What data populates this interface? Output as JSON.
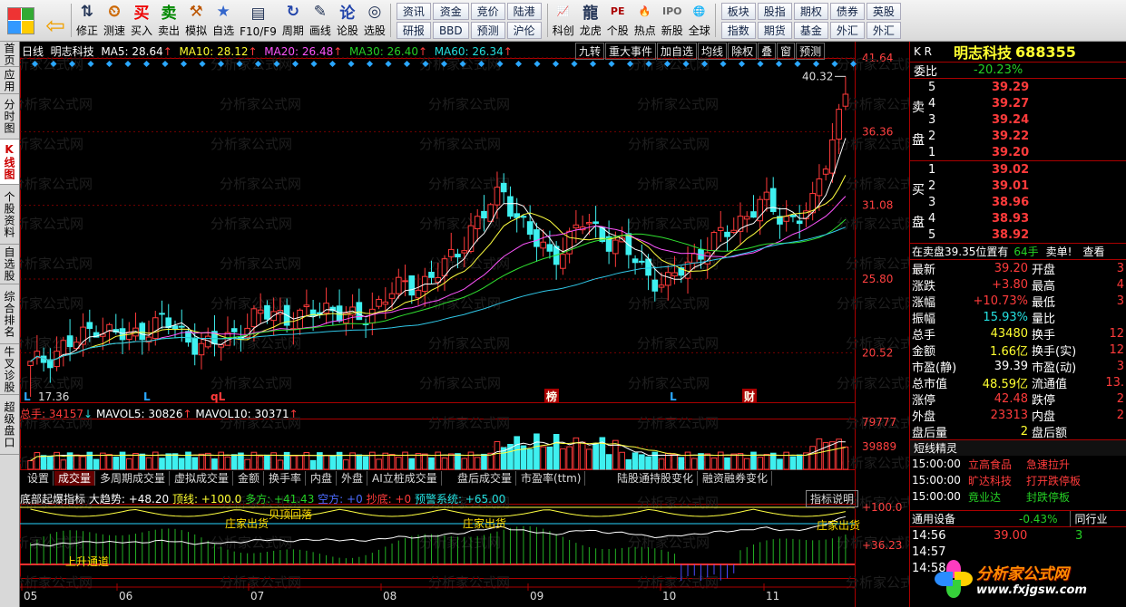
{
  "toolbar": {
    "buttons": [
      {
        "label": "修正",
        "icon": "up-down-arrows-icon"
      },
      {
        "label": "测速",
        "icon": "clock-icon"
      },
      {
        "label": "买入",
        "icon": "buy-icon"
      },
      {
        "label": "卖出",
        "icon": "sell-icon"
      },
      {
        "label": "模拟",
        "icon": "gavel-icon"
      },
      {
        "label": "自选",
        "icon": "star-icon"
      },
      {
        "label": "F10/F9",
        "icon": "document-icon"
      },
      {
        "label": "周期",
        "icon": "cycle-icon"
      },
      {
        "label": "画线",
        "icon": "pencil-icon"
      },
      {
        "label": "论股",
        "icon": "discussion-icon"
      },
      {
        "label": "选股",
        "icon": "stock-pick-icon"
      }
    ],
    "grid1": [
      "资讯",
      "研报",
      "资金",
      "BBD",
      "竞价",
      "预测",
      "陆港",
      "沪伦"
    ],
    "buttons2": [
      {
        "label": "科创",
        "icon": "sci-tech-icon"
      },
      {
        "label": "龙虎",
        "icon": "dragon-tiger-icon"
      },
      {
        "label": "个股",
        "icon": "pe-icon"
      },
      {
        "label": "热点",
        "icon": "hot-icon"
      },
      {
        "label": "新股",
        "icon": "ipo-icon"
      },
      {
        "label": "全球",
        "icon": "globe-icon"
      }
    ],
    "grid2": [
      "板块",
      "指数",
      "股指",
      "期货",
      "期权",
      "基金",
      "债券",
      "外汇",
      "英股",
      "外汇"
    ]
  },
  "left_tabs": [
    "首页",
    "应用",
    "分时图",
    "K线图",
    "个股资料",
    "自选股",
    "综合排名",
    "牛叉诊股",
    "超级盘口"
  ],
  "chart_header": {
    "period": "日线",
    "name": "明志科技",
    "ma5": "MA5: 28.64",
    "ma10": "MA10: 28.12",
    "ma20": "MA20: 26.48",
    "ma30": "MA30: 26.40",
    "ma60": "MA60: 26.34",
    "right_tabs": [
      "九转",
      "重大事件",
      "加自选",
      "均线",
      "除权",
      "叠",
      "窗",
      "预测"
    ]
  },
  "price_axis": [
    "41.64",
    "36.36",
    "31.08",
    "25.80",
    "20.52"
  ],
  "high_marker": "40.32",
  "low_marker": "17.36",
  "markers": [
    "L",
    "L",
    "qL",
    "榜",
    "L",
    "财"
  ],
  "volume_header": {
    "total": "总手: 34157",
    "mavol5": "MAVOL5: 30826",
    "mavol10": "MAVOL10: 30371"
  },
  "volume_axis": [
    "79777",
    "39889"
  ],
  "indicator_tabs": [
    "设置",
    "成交量",
    "多周期成交量",
    "虚拟成交量",
    "金额",
    "换手率",
    "内盘",
    "外盘",
    "AI立桩成交量",
    "盘后成交量",
    "市盈率(ttm)",
    "陆股通持股变化",
    "融资融券变化"
  ],
  "indicator_header": {
    "name": "底部起爆指标",
    "trend": "大趋势: +48.20",
    "top": "顶线: +100.0",
    "long": "多方: +41.43",
    "short": "空方: +0",
    "bottom": "抄底: +0",
    "alert": "预警系统: +65.00",
    "help": "指标说明"
  },
  "indicator_axis": [
    "+100.0",
    "+36.23"
  ],
  "indicator_labels": [
    "庄家出货",
    "贝顶回落",
    "庄家出货",
    "上升通道",
    "庄家出货"
  ],
  "x_axis": [
    "05",
    "06",
    "07",
    "08",
    "09",
    "10",
    "11"
  ],
  "quote": {
    "code": "688355",
    "name": "明志科技",
    "market": "K R",
    "weibi_label": "委比",
    "weibi": "-20.23%",
    "sell_label": "卖盘",
    "buy_label": "买盘",
    "asks": [
      {
        "lvl": "5",
        "price": "39.29"
      },
      {
        "lvl": "4",
        "price": "39.27"
      },
      {
        "lvl": "3",
        "price": "39.24"
      },
      {
        "lvl": "2",
        "price": "39.22"
      },
      {
        "lvl": "1",
        "price": "39.20"
      }
    ],
    "bids": [
      {
        "lvl": "1",
        "price": "39.02"
      },
      {
        "lvl": "2",
        "price": "39.01"
      },
      {
        "lvl": "3",
        "price": "38.96"
      },
      {
        "lvl": "4",
        "price": "38.93"
      },
      {
        "lvl": "5",
        "price": "38.92"
      }
    ],
    "position_note": "在卖盘39.35位置有",
    "position_vol": "64手",
    "position_sell": "卖单!",
    "position_view": "查看",
    "stats": [
      {
        "k": "最新",
        "v": "39.20",
        "k2": "开盘",
        "v2": "3"
      },
      {
        "k": "涨跌",
        "v": "+3.80",
        "k2": "最高",
        "v2": "4"
      },
      {
        "k": "涨幅",
        "v": "+10.73%",
        "k2": "最低",
        "v2": "3"
      },
      {
        "k": "振幅",
        "v": "15.93%",
        "k2": "量比",
        "v2": ""
      },
      {
        "k": "总手",
        "v": "43480",
        "k2": "换手",
        "v2": "12"
      },
      {
        "k": "金额",
        "v": "1.66亿",
        "k2": "换手(实)",
        "v2": "12"
      },
      {
        "k": "市盈(静)",
        "v": "39.39",
        "k2": "市盈(动)",
        "v2": "3"
      },
      {
        "k": "总市值",
        "v": "48.59亿",
        "k2": "流通值",
        "v2": "13."
      },
      {
        "k": "涨停",
        "v": "42.48",
        "k2": "跌停",
        "v2": "2"
      },
      {
        "k": "外盘",
        "v": "23313",
        "k2": "内盘",
        "v2": "2"
      },
      {
        "k": "盘后量",
        "v": "2",
        "k2": "盘后额",
        "v2": ""
      }
    ],
    "news_title": "短线精灵",
    "news": [
      {
        "t": "15:00:00",
        "stock": "立高食品",
        "event": "急速拉升"
      },
      {
        "t": "15:00:00",
        "stock": "旷达科技",
        "event": "打开跌停板"
      },
      {
        "t": "15:00:00",
        "stock": "竟业达",
        "event": "封跌停板"
      }
    ],
    "sector": {
      "name": "通用设备",
      "chg": "-0.43%",
      "tab": "同行业"
    },
    "ticks": [
      {
        "t": "14:56",
        "p": "39.00",
        "v": "3"
      },
      {
        "t": "14:57",
        "p": "",
        "v": ""
      },
      {
        "t": "14:58",
        "p": "",
        "v": ""
      }
    ]
  },
  "watermark": {
    "brand": "分析家公式网",
    "url": "www.fxjgsw.com"
  },
  "chart_data": {
    "type": "candlestick",
    "title": "明志科技 日线",
    "x": [
      "05",
      "06",
      "07",
      "08",
      "09",
      "10",
      "11"
    ],
    "ylim": [
      17.36,
      41.64
    ],
    "price_path": [
      19.5,
      20.2,
      21.0,
      21.3,
      22.6,
      21.9,
      21.5,
      22.3,
      22.8,
      22.1,
      21.4,
      20.8,
      21.6,
      22.4,
      23.0,
      23.6,
      22.8,
      23.1,
      24.0,
      23.4,
      22.6,
      23.8,
      24.8,
      25.2,
      25.6,
      26.2,
      27.4,
      29.5,
      30.6,
      32.2,
      30.1,
      28.3,
      27.4,
      28.6,
      29.9,
      29.1,
      28.2,
      27.3,
      26.1,
      25.2,
      26.6,
      27.8,
      28.4,
      29.5,
      30.6,
      31.2,
      30.4,
      30.1,
      31.0,
      35.4,
      39.2
    ],
    "volume_ylim": [
      0,
      79777
    ]
  }
}
